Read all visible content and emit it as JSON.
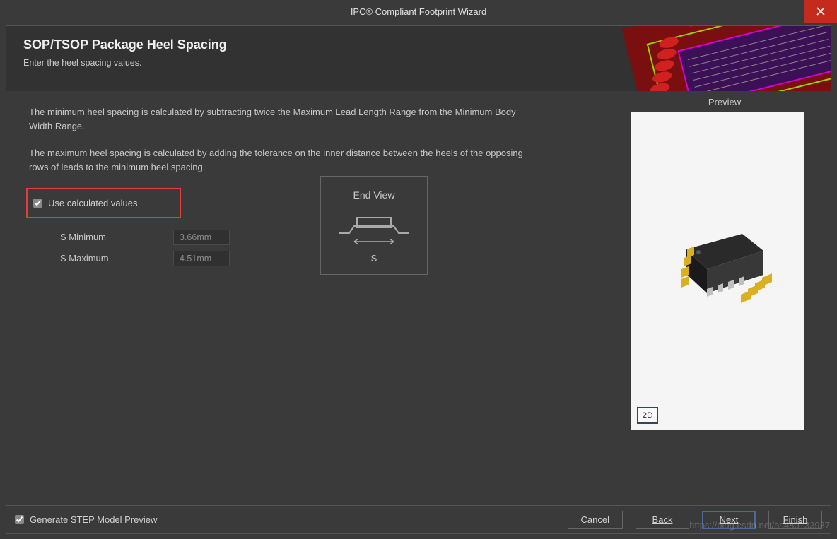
{
  "window": {
    "title": "IPC® Compliant Footprint Wizard"
  },
  "header": {
    "title": "SOP/TSOP Package Heel Spacing",
    "subtitle": "Enter the heel spacing values."
  },
  "description": {
    "para1": "The minimum heel spacing is calculated by subtracting twice the Maximum Lead Length Range from the Minimum Body Width Range.",
    "para2": "The maximum heel spacing is calculated by adding the tolerance on the inner distance between the heels of the opposing rows of leads to the minimum heel spacing."
  },
  "checkbox": {
    "use_calc_label": "Use calculated values",
    "use_calc_checked": true
  },
  "params": {
    "s_min_label": "S Minimum",
    "s_min_value": "3.66mm",
    "s_max_label": "S Maximum",
    "s_max_value": "4.51mm"
  },
  "endview": {
    "title": "End View",
    "dim_label": "S"
  },
  "preview": {
    "label": "Preview",
    "toggle_label": "2D"
  },
  "footer": {
    "step_label": "Generate STEP Model Preview",
    "step_checked": true,
    "cancel": "Cancel",
    "back": "Back",
    "next": "Next",
    "finish": "Finish"
  },
  "watermark": "https://blog.csdn.net/as480133937"
}
